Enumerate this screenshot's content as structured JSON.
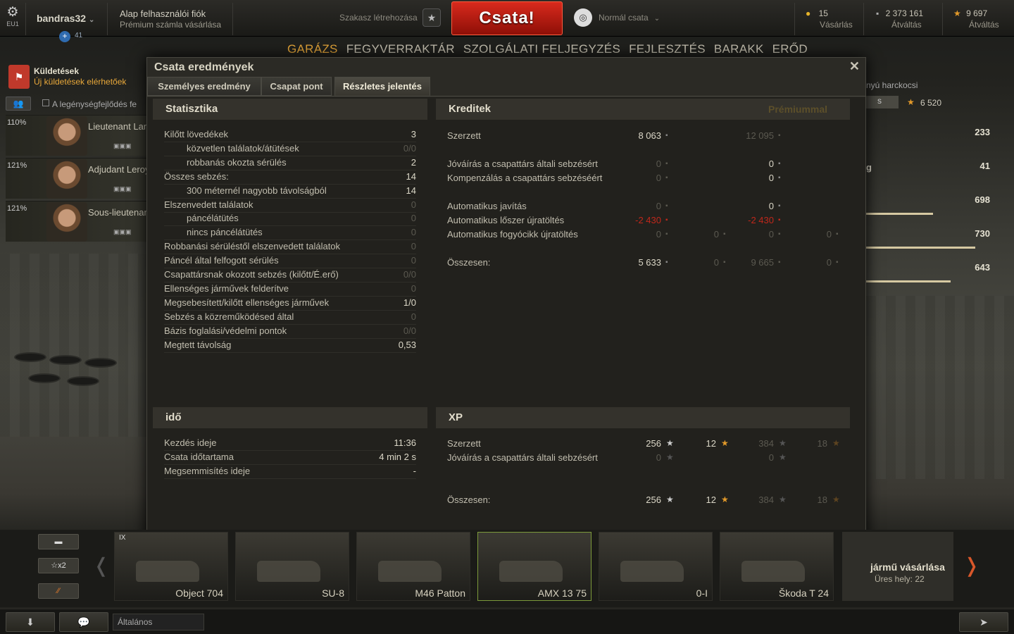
{
  "topbar": {
    "server": "EU1",
    "username": "bandras32",
    "rank_icon": "plus-icon",
    "rank_count": "41",
    "account_type": "Alap felhasználói fiók",
    "premium_link": "Prémium számla vásárlása",
    "platoon_label": "Szakasz létrehozása",
    "battle_button": "Csata!",
    "mode_label": "Normál csata",
    "gold_value": "15",
    "gold_action": "Vásárlás",
    "credits_value": "2 373 161",
    "credits_action": "Átváltás",
    "freexp_value": "9 697",
    "freexp_action": "Átváltás"
  },
  "nav": {
    "items": [
      "GARÁZS",
      "FEGYVERRAKTÁR",
      "SZOLGÁLATI FELJEGYZÉS",
      "FEJLESZTÉS",
      "BARAKK",
      "ERŐD"
    ],
    "active": "GARÁZS"
  },
  "quests": {
    "title": "Küldetések",
    "subtitle": "Új küldetések elérhetőek"
  },
  "crew_bar": {
    "text": "A legénységfejlődés fe"
  },
  "crew": [
    {
      "pct": "110%",
      "name": "Lieutenant Lan"
    },
    {
      "pct": "121%",
      "name": "Adjudant Leroy"
    },
    {
      "pct": "121%",
      "name": "Sous-lieutenan"
    }
  ],
  "right_panel": {
    "title": "nyú harckocsi",
    "value": "6 520",
    "letter": "g",
    "stats": [
      "233",
      "41",
      "698",
      "730",
      "643"
    ],
    "bar_levels": [
      0.55,
      0.9,
      0.7,
      0.6
    ]
  },
  "dialog": {
    "title": "Csata eredmények",
    "close_icon": "close-icon",
    "tabs": [
      "Személyes eredmény",
      "Csapat pont",
      "Részletes jelentés"
    ],
    "active_tab": "Részletes jelentés",
    "statistics": {
      "header": "Statisztika",
      "rows": [
        {
          "label": "Kilőtt lövedékek",
          "value": "3",
          "indent": false,
          "dim": false
        },
        {
          "label": "közvetlen találatok/átütések",
          "value": "0/0",
          "indent": true,
          "dim": true
        },
        {
          "label": "robbanás okozta sérülés",
          "value": "2",
          "indent": true,
          "dim": false
        },
        {
          "label": "Összes sebzés:",
          "value": "14",
          "indent": false,
          "dim": false
        },
        {
          "label": "300 méternél nagyobb távolságból",
          "value": "14",
          "indent": true,
          "dim": false
        },
        {
          "label": "Elszenvedett találatok",
          "value": "0",
          "indent": false,
          "dim": true
        },
        {
          "label": "páncélátütés",
          "value": "0",
          "indent": true,
          "dim": true
        },
        {
          "label": "nincs páncélátütés",
          "value": "0",
          "indent": true,
          "dim": true
        },
        {
          "label": "Robbanási sérüléstől elszenvedett találatok",
          "value": "0",
          "indent": false,
          "dim": true
        },
        {
          "label": "Páncél által felfogott sérülés",
          "value": "0",
          "indent": false,
          "dim": true
        },
        {
          "label": "Csapattársnak okozott sebzés (kilőtt/É.erő)",
          "value": "0/0",
          "indent": false,
          "dim": true
        },
        {
          "label": "Ellenséges járművek felderítve",
          "value": "0",
          "indent": false,
          "dim": true
        },
        {
          "label": "Megsebesített/kilőtt ellenséges járművek",
          "value": "1/0",
          "indent": false,
          "dim": false
        },
        {
          "label": "Sebzés a közreműködésed által",
          "value": "0",
          "indent": false,
          "dim": true
        },
        {
          "label": "Bázis foglalási/védelmi pontok",
          "value": "0/0",
          "indent": false,
          "dim": true
        },
        {
          "label": "Megtett távolság",
          "value": "0,53",
          "indent": false,
          "dim": false
        }
      ]
    },
    "credits": {
      "header": "Kreditek",
      "premium_header": "Prémiummal",
      "rows": [
        {
          "label": "Szerzett",
          "c1": "8 063",
          "c2": "",
          "c3": "12 095",
          "c4": "",
          "c1dim": false,
          "c3dim": true,
          "red": false
        },
        {
          "label": "Jóváírás a csapattárs általi sebzésért",
          "c1": "0",
          "c2": "",
          "c3": "0",
          "c4": "",
          "c1dim": true,
          "c3dim": false,
          "red": false
        },
        {
          "label": "Kompenzálás a csapattárs sebzéséért",
          "c1": "0",
          "c2": "",
          "c3": "0",
          "c4": "",
          "c1dim": true,
          "c3dim": false,
          "red": false
        },
        {
          "label": "Automatikus javítás",
          "c1": "0",
          "c2": "",
          "c3": "0",
          "c4": "",
          "c1dim": true,
          "c3dim": false,
          "red": false
        },
        {
          "label": "Automatikus lőszer újratöltés",
          "c1": "-2 430",
          "c2": "",
          "c3": "-2 430",
          "c4": "",
          "c1dim": false,
          "c3dim": true,
          "red": true
        },
        {
          "label": "Automatikus fogyócikk újratöltés",
          "c1": "0",
          "c2": "0",
          "c3": "0",
          "c4": "0",
          "c1dim": true,
          "c3dim": true,
          "red": false
        },
        {
          "label": "Összesen:",
          "c1": "5 633",
          "c2": "0",
          "c3": "9 665",
          "c4": "0",
          "c1dim": false,
          "c3dim": true,
          "red": false
        }
      ]
    },
    "time": {
      "header": "idő",
      "rows": [
        {
          "label": "Kezdés ideje",
          "value": "11:36"
        },
        {
          "label": "Csata időtartama",
          "value": "4 min 2 s"
        },
        {
          "label": "Megsemmisítés ideje",
          "value": "-"
        }
      ]
    },
    "xp": {
      "header": "XP",
      "rows": [
        {
          "label": "Szerzett",
          "c1": "256",
          "c2": "12",
          "c3": "384",
          "c4": "18",
          "c1dim": false
        },
        {
          "label": "Jóváírás a csapattárs általi sebzésért",
          "c1": "0",
          "c2": "",
          "c3": "0",
          "c4": "",
          "c1dim": true
        },
        {
          "label": "Összesen:",
          "c1": "256",
          "c2": "12",
          "c3": "384",
          "c4": "18",
          "c1dim": false
        }
      ]
    }
  },
  "carousel": {
    "filters": [
      "tank-icon",
      "x2",
      "stripe-icon"
    ],
    "filter_x2": "x2",
    "tanks": [
      {
        "name": "Object 704",
        "tier": "IX",
        "selected": false
      },
      {
        "name": "SU-8",
        "tier": "",
        "selected": false
      },
      {
        "name": "M46 Patton",
        "tier": "",
        "selected": false
      },
      {
        "name": "AMX 13 75",
        "tier": "",
        "selected": true
      },
      {
        "name": "0-I",
        "tier": "",
        "selected": false
      },
      {
        "name": "Škoda T 24",
        "tier": "",
        "selected": false
      }
    ],
    "buy_title": "jármű vásárlása",
    "buy_slots": "Üres hely: 22"
  },
  "bottombar": {
    "chat_channel": "Általános"
  },
  "colors": {
    "accent_orange": "#e8a83a",
    "battle_red": "#d82a1d",
    "negative_red": "#c0271b",
    "selected_green": "#7c9a3a"
  }
}
